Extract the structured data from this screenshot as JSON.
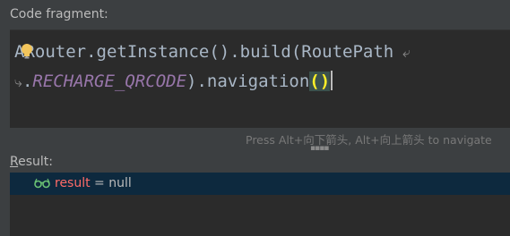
{
  "labels": {
    "code_fragment": "Code fragment:",
    "result": "Result:"
  },
  "code": {
    "line1": "ARouter.getInstance().build(RoutePath",
    "line2_prefix": ".",
    "line2_const": "RECHARGE_QRCODE",
    "line2_call": ").navigation",
    "line2_parens": "()"
  },
  "hint": "Press Alt+向下箭头, Alt+向上箭头 to navigate",
  "result": {
    "variable": "result",
    "equals": " = ",
    "value": "null"
  },
  "icons": {
    "intention": "lightbulb-icon",
    "wrap": "soft-wrap-icon",
    "watch": "watch-glasses-icon",
    "grip": "resize-grip-icon"
  },
  "colors": {
    "background": "#3c3f41",
    "editor": "#2b2b2b",
    "selected_row": "#0d293e",
    "constant": "#9876aa",
    "variable": "#ff6b68",
    "paren_highlight": "#ffef28"
  }
}
